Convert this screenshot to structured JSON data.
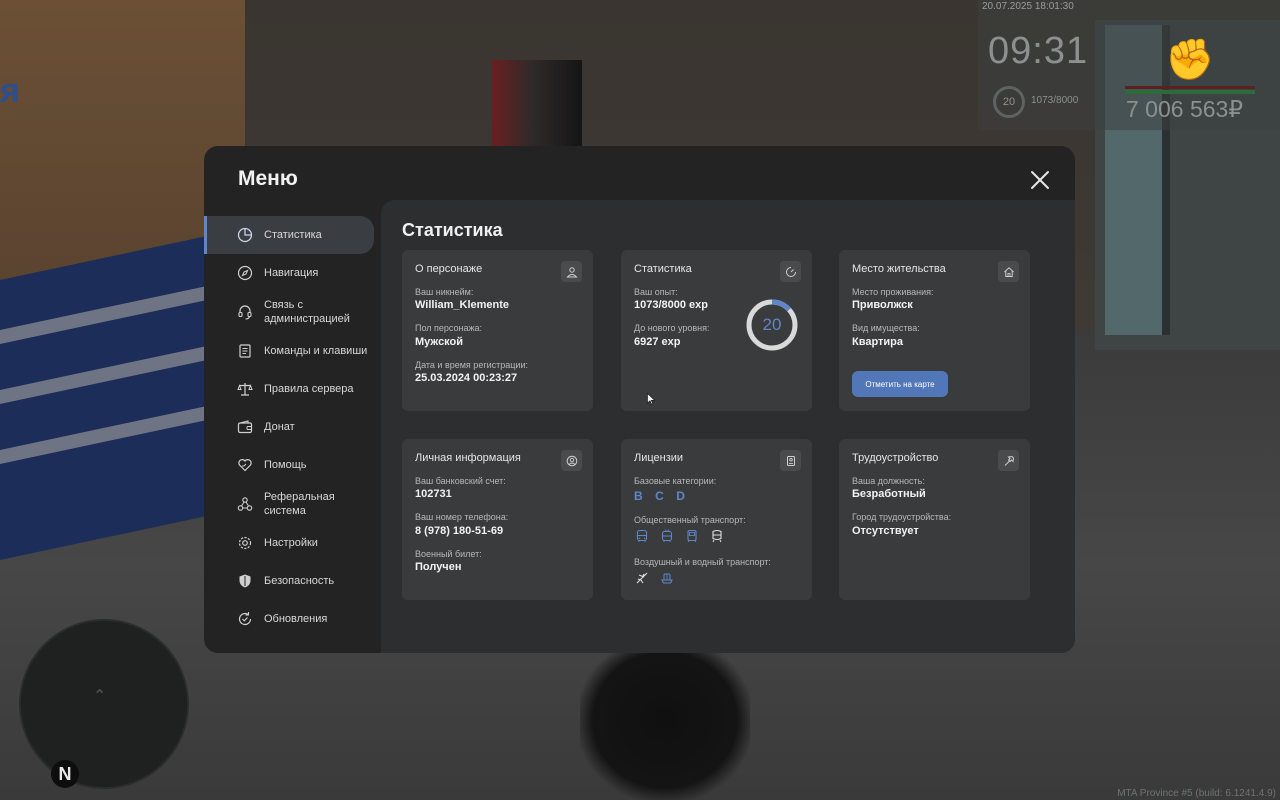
{
  "hud": {
    "date": "20.07.2025 18:01:30",
    "time": "09:31",
    "level": "20",
    "exp": "1073/8000",
    "money": "7 006 563₽"
  },
  "footer": {
    "build": "MTA Province #5 (build: 6.1241.4.9)"
  },
  "minimap": {
    "north": "N"
  },
  "menu": {
    "title": "Меню",
    "sidebar": [
      {
        "label": "Статистика",
        "icon": "pie-chart-icon",
        "active": true
      },
      {
        "label": "Навигация",
        "icon": "compass-icon"
      },
      {
        "label": "Связь с администрацией",
        "icon": "headset-icon"
      },
      {
        "label": "Команды и клавиши",
        "icon": "document-icon"
      },
      {
        "label": "Правила сервера",
        "icon": "scales-icon"
      },
      {
        "label": "Донат",
        "icon": "wallet-icon"
      },
      {
        "label": "Помощь",
        "icon": "heart-hand-icon"
      },
      {
        "label": "Реферальная система",
        "icon": "users-network-icon"
      },
      {
        "label": "Настройки",
        "icon": "gear-icon"
      },
      {
        "label": "Безопасность",
        "icon": "shield-icon"
      },
      {
        "label": "Обновления",
        "icon": "refresh-icon"
      }
    ]
  },
  "content": {
    "title": "Статистика",
    "character": {
      "title": "О персонаже",
      "nickname_label": "Ваш никнейм:",
      "nickname": "William_Klemente",
      "gender_label": "Пол персонажа:",
      "gender": "Мужской",
      "reg_label": "Дата и время регистрации:",
      "reg": "25.03.2024 00:23:27"
    },
    "stats": {
      "title": "Статистика",
      "exp_label": "Ваш опыт:",
      "exp": "1073/8000 exp",
      "next_label": "До нового уровня:",
      "next": "6927 exp",
      "level": "20",
      "progress": 0.134
    },
    "residence": {
      "title": "Место жительства",
      "place_label": "Место проживания:",
      "place": "Приволжск",
      "property_label": "Вид имущества:",
      "property": "Квартира",
      "button": "Отметить на карте"
    },
    "personal": {
      "title": "Личная информация",
      "bank_label": "Ваш банковский счет:",
      "bank": "102731",
      "phone_label": "Ваш номер телефона:",
      "phone": "8 (978) 180-51-69",
      "military_label": "Военный билет:",
      "military": "Получен"
    },
    "licenses": {
      "title": "Лицензии",
      "base_label": "Базовые категории:",
      "base": [
        "B",
        "C",
        "D"
      ],
      "public_label": "Общественный транспорт:",
      "public_icons": [
        "bus-icon",
        "trolleybus-icon",
        "tram-icon",
        "train-icon"
      ],
      "air_label": "Воздушный и водный транспорт:",
      "air_icons": [
        "airplane-icon",
        "boat-icon"
      ]
    },
    "job": {
      "title": "Трудоустройство",
      "position_label": "Ваша должность:",
      "position": "Безработный",
      "city_label": "Город трудоустройства:",
      "city": "Отсутствует"
    }
  },
  "colors": {
    "accent": "#5f86c9",
    "button": "#5177b8",
    "card": "#3a3b3c",
    "panel": "#2d2e30",
    "window": "#232323"
  }
}
